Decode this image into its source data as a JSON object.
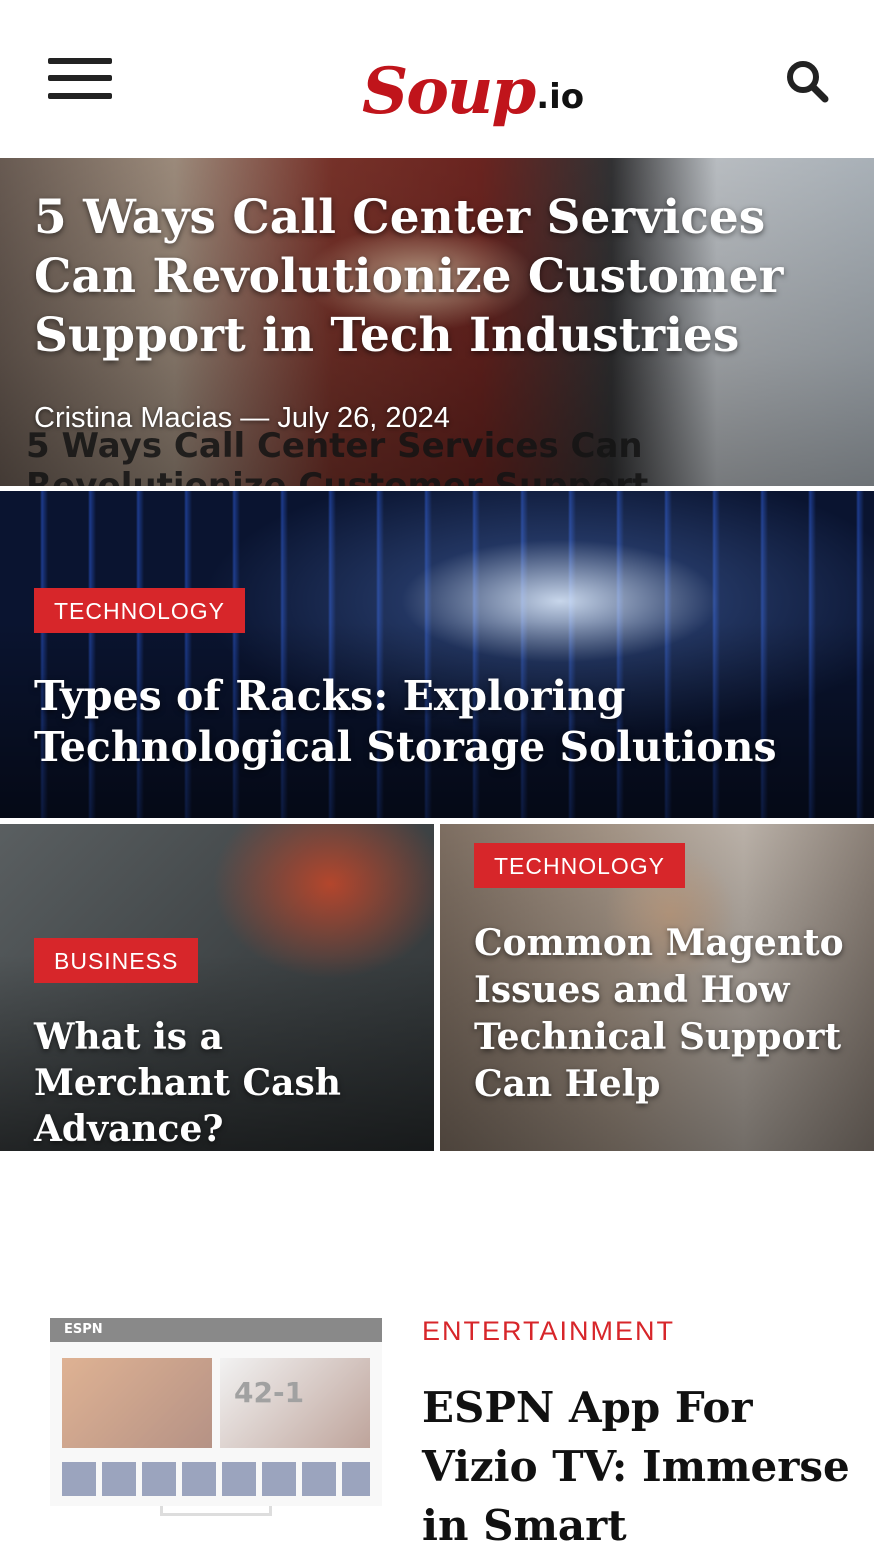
{
  "header": {
    "logo_main": "Soup",
    "logo_tld": ".io"
  },
  "featured": [
    {
      "title": "5 Ways Call Center Services Can Revolutionize Customer Support in Tech Industries",
      "author": "Cristina Macias",
      "separator": "—",
      "date": "July 26, 2024",
      "ghost_text_line1": "5 Ways Call Center Services Can",
      "ghost_text_line2": "Revolutionize Customer Support"
    },
    {
      "category": "TECHNOLOGY",
      "title": "Types of Racks: Exploring Technological Storage Solutions"
    },
    {
      "category": "BUSINESS",
      "title": "What is a Merchant Cash Advance?"
    },
    {
      "category": "TECHNOLOGY",
      "title": "Common Magento Issues and How Technical Support Can Help"
    }
  ],
  "list": [
    {
      "category": "ENTERTAINMENT",
      "title": "ESPN App For Vizio TV: Immerse in Smart",
      "thumb_brand": "ESPN",
      "thumb_score": "42-1"
    }
  ],
  "colors": {
    "brand_red": "#c0141b",
    "tag_red": "#d7262a"
  },
  "icons": [
    "hamburger-menu-icon",
    "search-icon"
  ]
}
